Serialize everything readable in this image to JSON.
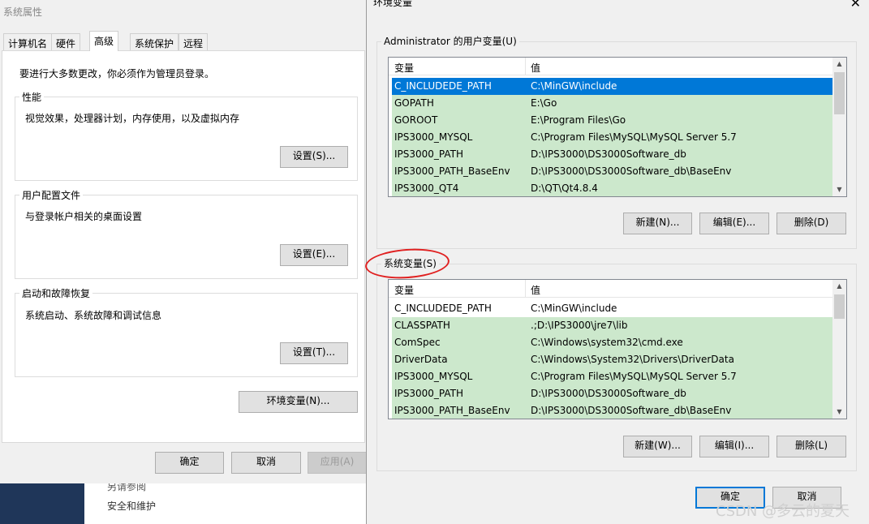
{
  "background": {
    "links": [
      "另请参阅",
      "安全和维护"
    ]
  },
  "system_properties": {
    "title": "系统属性",
    "tabs": [
      "计算机名",
      "硬件",
      "高级",
      "系统保护",
      "远程"
    ],
    "active_tab": "高级",
    "admin_note": "要进行大多数更改，你必须作为管理员登录。",
    "performance": {
      "legend": "性能",
      "description": "视觉效果，处理器计划，内存使用，以及虚拟内存",
      "button": "设置(S)..."
    },
    "user_profiles": {
      "legend": "用户配置文件",
      "description": "与登录帐户相关的桌面设置",
      "button": "设置(E)..."
    },
    "startup_recovery": {
      "legend": "启动和故障恢复",
      "description": "系统启动、系统故障和调试信息",
      "button": "设置(T)..."
    },
    "env_button": "环境变量(N)...",
    "ok": "确定",
    "cancel": "取消",
    "apply": "应用(A)"
  },
  "env_dialog": {
    "title": "环境变量",
    "close_icon": "close-icon",
    "user_vars": {
      "legend": "Administrator 的用户变量(U)",
      "col_var": "变量",
      "col_val": "值",
      "rows": [
        {
          "var": "C_INCLUDEDE_PATH",
          "val": "C:\\MinGW\\include"
        },
        {
          "var": "GOPATH",
          "val": "E:\\Go"
        },
        {
          "var": "GOROOT",
          "val": "E:\\Program Files\\Go"
        },
        {
          "var": "IPS3000_MYSQL",
          "val": "C:\\Program Files\\MySQL\\MySQL Server 5.7"
        },
        {
          "var": "IPS3000_PATH",
          "val": "D:\\IPS3000\\DS3000Software_db"
        },
        {
          "var": "IPS3000_PATH_BaseEnv",
          "val": "D:\\IPS3000\\DS3000Software_db\\BaseEnv"
        },
        {
          "var": "IPS3000_QT4",
          "val": "D:\\QT\\Qt4.8.4"
        }
      ],
      "selected_index": 0,
      "buttons": {
        "new": "新建(N)...",
        "edit": "编辑(E)...",
        "delete": "删除(D)"
      }
    },
    "system_vars": {
      "legend": "系统变量(S)",
      "col_var": "变量",
      "col_val": "值",
      "rows": [
        {
          "var": "C_INCLUDEDE_PATH",
          "val": "C:\\MinGW\\include"
        },
        {
          "var": "CLASSPATH",
          "val": ".;D:\\IPS3000\\jre7\\lib"
        },
        {
          "var": "ComSpec",
          "val": "C:\\Windows\\system32\\cmd.exe"
        },
        {
          "var": "DriverData",
          "val": "C:\\Windows\\System32\\Drivers\\DriverData"
        },
        {
          "var": "IPS3000_MYSQL",
          "val": "C:\\Program Files\\MySQL\\MySQL Server 5.7"
        },
        {
          "var": "IPS3000_PATH",
          "val": "D:\\IPS3000\\DS3000Software_db"
        },
        {
          "var": "IPS3000_PATH_BaseEnv",
          "val": "D:\\IPS3000\\DS3000Software_db\\BaseEnv"
        }
      ],
      "buttons": {
        "new": "新建(W)...",
        "edit": "编辑(I)...",
        "delete": "删除(L)"
      }
    },
    "ok": "确定",
    "cancel": "取消"
  },
  "watermark": "CSDN @多云的夏天",
  "colors": {
    "selection": "#0078d7",
    "row_highlight": "#cce8cc",
    "annotation": "#e02020"
  }
}
